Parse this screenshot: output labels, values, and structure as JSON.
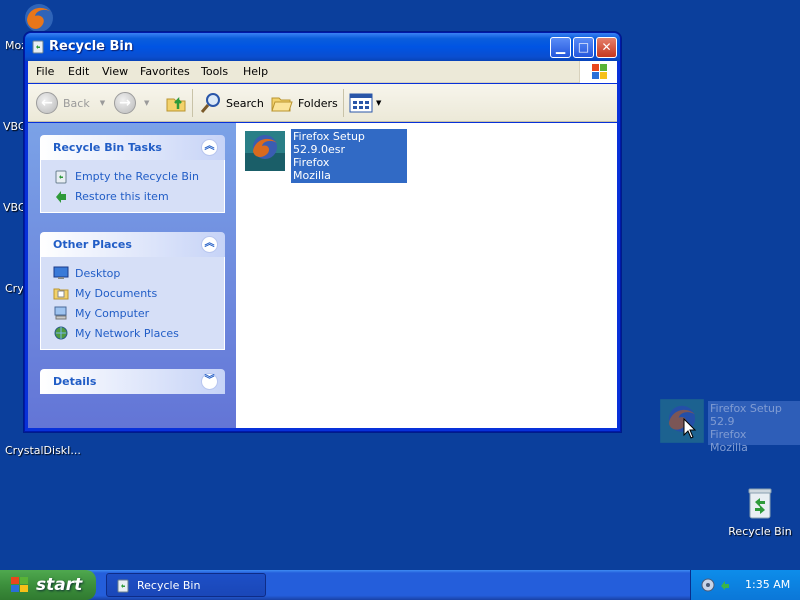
{
  "desktop": {
    "icons": [
      {
        "label": "Moz"
      },
      {
        "label": "VBC"
      },
      {
        "label": "VBC"
      },
      {
        "label": "Cry"
      },
      {
        "label": "CrystalDiskI..."
      },
      {
        "label": "Recycle Bin"
      }
    ]
  },
  "window": {
    "title": "Recycle Bin",
    "menu": [
      "File",
      "Edit",
      "View",
      "Favorites",
      "Tools",
      "Help"
    ],
    "toolbar": {
      "back": "Back",
      "search": "Search",
      "folders": "Folders"
    },
    "tasks_panel": {
      "title": "Recycle Bin Tasks",
      "items": [
        "Empty the Recycle Bin",
        "Restore this item"
      ]
    },
    "places_panel": {
      "title": "Other Places",
      "items": [
        "Desktop",
        "My Documents",
        "My Computer",
        "My Network Places"
      ]
    },
    "details_panel": {
      "title": "Details"
    },
    "file": {
      "name": "Firefox Setup 52.9.0esr",
      "line2": "Firefox",
      "line3": "Mozilla"
    }
  },
  "drag_ghost": {
    "name": "Firefox Setup 52.9",
    "line2": "Firefox",
    "line3": "Mozilla"
  },
  "taskbar": {
    "start_label": "start",
    "task_label": "Recycle Bin",
    "clock": "1:35 AM"
  },
  "colors": {
    "desktop": "#0b3f9c",
    "titlebar": "#0054e3",
    "selection": "#316ac5",
    "link": "#215dc6"
  }
}
